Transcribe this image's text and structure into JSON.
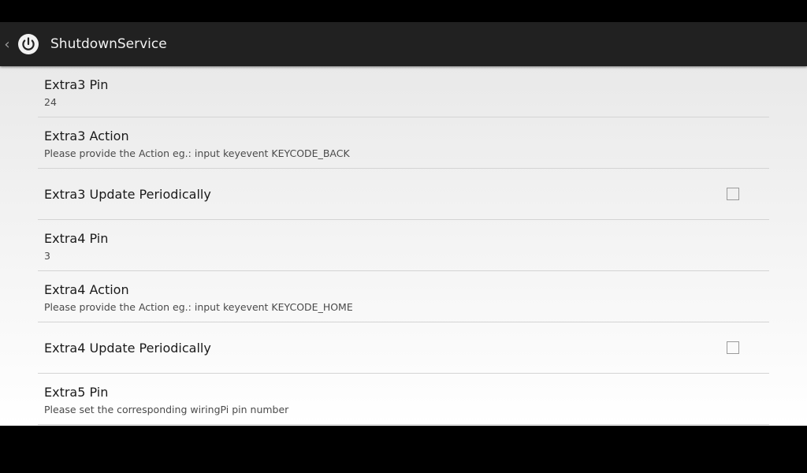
{
  "app": {
    "title": "ShutdownService",
    "up_caret": "‹"
  },
  "preferences": [
    {
      "title": "Extra3 Pin",
      "summary": "24"
    },
    {
      "title": "Extra3 Action",
      "summary": "Please provide the Action eg.: input keyevent  KEYCODE_BACK"
    },
    {
      "title": "Extra3 Update Periodically",
      "checked": false
    },
    {
      "title": "Extra4 Pin",
      "summary": "3"
    },
    {
      "title": "Extra4 Action",
      "summary": "Please provide the Action eg.: input keyevent  KEYCODE_HOME"
    },
    {
      "title": "Extra4 Update Periodically",
      "checked": false
    },
    {
      "title": "Extra5 Pin",
      "summary": "Please set the corresponding wiringPi pin number"
    }
  ],
  "colors": {
    "action_bar": "#212121",
    "title_text": "#f2f2f2",
    "divider": "#d4d4d4"
  },
  "icons": {
    "app_icon": "power-icon",
    "up": "chevron-left-icon"
  }
}
